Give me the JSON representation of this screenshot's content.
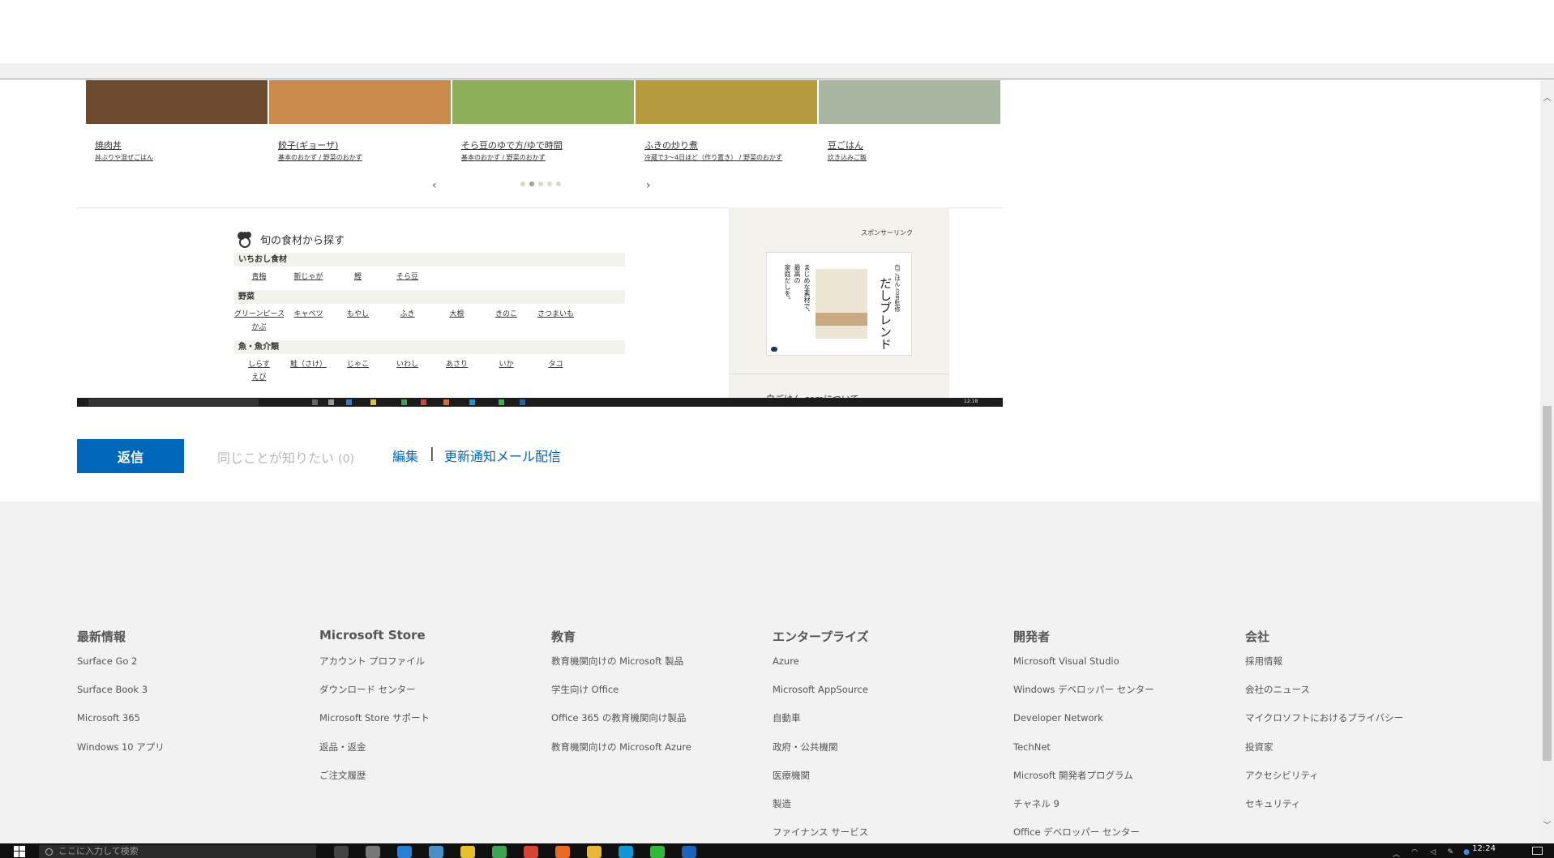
{
  "embedded": {
    "recipes": [
      {
        "title": "焼肉丼",
        "category": "丼ぶりや混ぜごはん",
        "img_color": "#6b4a2f"
      },
      {
        "title": "餃子(ギョーザ)",
        "category": "基本のおかず / 野菜のおかず",
        "img_color": "#c98a4b"
      },
      {
        "title": "そら豆のゆで方/ゆで時間",
        "category": "基本のおかず / 野菜のおかず",
        "img_color": "#8fae5a"
      },
      {
        "title": "ふきの炒り煮",
        "category": "冷蔵で3〜4日ほど（作り置き） / 野菜のおかず",
        "img_color": "#b59a3e"
      },
      {
        "title": "豆ごはん",
        "category": "炊き込みご飯",
        "img_color": "#a8b5a0"
      }
    ],
    "carousel": {
      "prev": "‹",
      "next": "›"
    },
    "season": {
      "title": "旬の食材から探す",
      "sections": [
        {
          "name": "いちおし食材",
          "items": [
            "青梅",
            "新じゃが",
            "鰹",
            "そら豆"
          ]
        },
        {
          "name": "野菜",
          "items": [
            "グリーンピース",
            "キャベツ",
            "もやし",
            "ふき",
            "大根",
            "きのこ",
            "さつまいも",
            "かぶ"
          ]
        },
        {
          "name": "魚・魚介類",
          "items": [
            "しらす",
            "鮭（さけ）",
            "じゃこ",
            "いわし",
            "あさり",
            "いか",
            "タコ",
            "えび"
          ]
        }
      ]
    },
    "sponsor": {
      "label": "スポンサーリンク",
      "ad_text_a": "まじめな素材で、",
      "ad_text_b": "最高の",
      "ad_text_c": "家庭だしを。",
      "ad_title": "だしブレンド",
      "ad_subtitle": "白ごはん.com監修",
      "about": "白ごはん.comについて"
    },
    "taskbar_clock": "12:18"
  },
  "actions": {
    "reply": "返信",
    "same_question": "同じことが知りたい",
    "same_count": "(0)",
    "edit": "編集",
    "separator": "|",
    "notify": "更新通知メール配信"
  },
  "footer": {
    "columns": [
      {
        "heading": "最新情報",
        "links": [
          "Surface Go 2",
          "Surface Book 3",
          "Microsoft 365",
          "Windows 10 アプリ"
        ]
      },
      {
        "heading": "Microsoft Store",
        "links": [
          "アカウント プロファイル",
          "ダウンロード センター",
          "Microsoft Store サポート",
          "返品・返金",
          "ご注文履歴"
        ]
      },
      {
        "heading": "教育",
        "links": [
          "教育機関向けの Microsoft 製品",
          "学生向け Office",
          "Office 365 の教育機関向け製品",
          "教育機関向けの Microsoft Azure"
        ]
      },
      {
        "heading": "エンタープライズ",
        "links": [
          "Azure",
          "Microsoft AppSource",
          "自動車",
          "政府・公共機関",
          "医療機関",
          "製造",
          "ファイナンス サービス"
        ]
      },
      {
        "heading": "開発者",
        "links": [
          "Microsoft Visual Studio",
          "Windows デベロッパー センター",
          "Developer Network",
          "TechNet",
          "Microsoft 開発者プログラム",
          "チャネル 9",
          "Office デベロッパー センター"
        ]
      },
      {
        "heading": "会社",
        "links": [
          "採用情報",
          "会社のニュース",
          "マイクロソフトにおけるプライバシー",
          "投資家",
          "アクセシビリティ",
          "セキュリティ"
        ]
      }
    ]
  },
  "taskbar": {
    "search_placeholder": "ここに入力して検索",
    "clock": "12:24",
    "icons": [
      {
        "name": "task-view-icon",
        "color": "#444"
      },
      {
        "name": "clock-app-icon",
        "color": "#777"
      },
      {
        "name": "edge-icon",
        "color": "#2a7fd4"
      },
      {
        "name": "photos-icon",
        "color": "#4a8fc7"
      },
      {
        "name": "sticky-icon",
        "color": "#e6c02a"
      },
      {
        "name": "browser-icon",
        "color": "#3aa655"
      },
      {
        "name": "chrome-icon",
        "color": "#d64436"
      },
      {
        "name": "firefox-icon",
        "color": "#e66a1f"
      },
      {
        "name": "folder-icon",
        "color": "#e8b739"
      },
      {
        "name": "skype-icon",
        "color": "#1196d8"
      },
      {
        "name": "line-icon",
        "color": "#2fb83a"
      },
      {
        "name": "outlook-icon",
        "color": "#1b62b8"
      }
    ]
  }
}
